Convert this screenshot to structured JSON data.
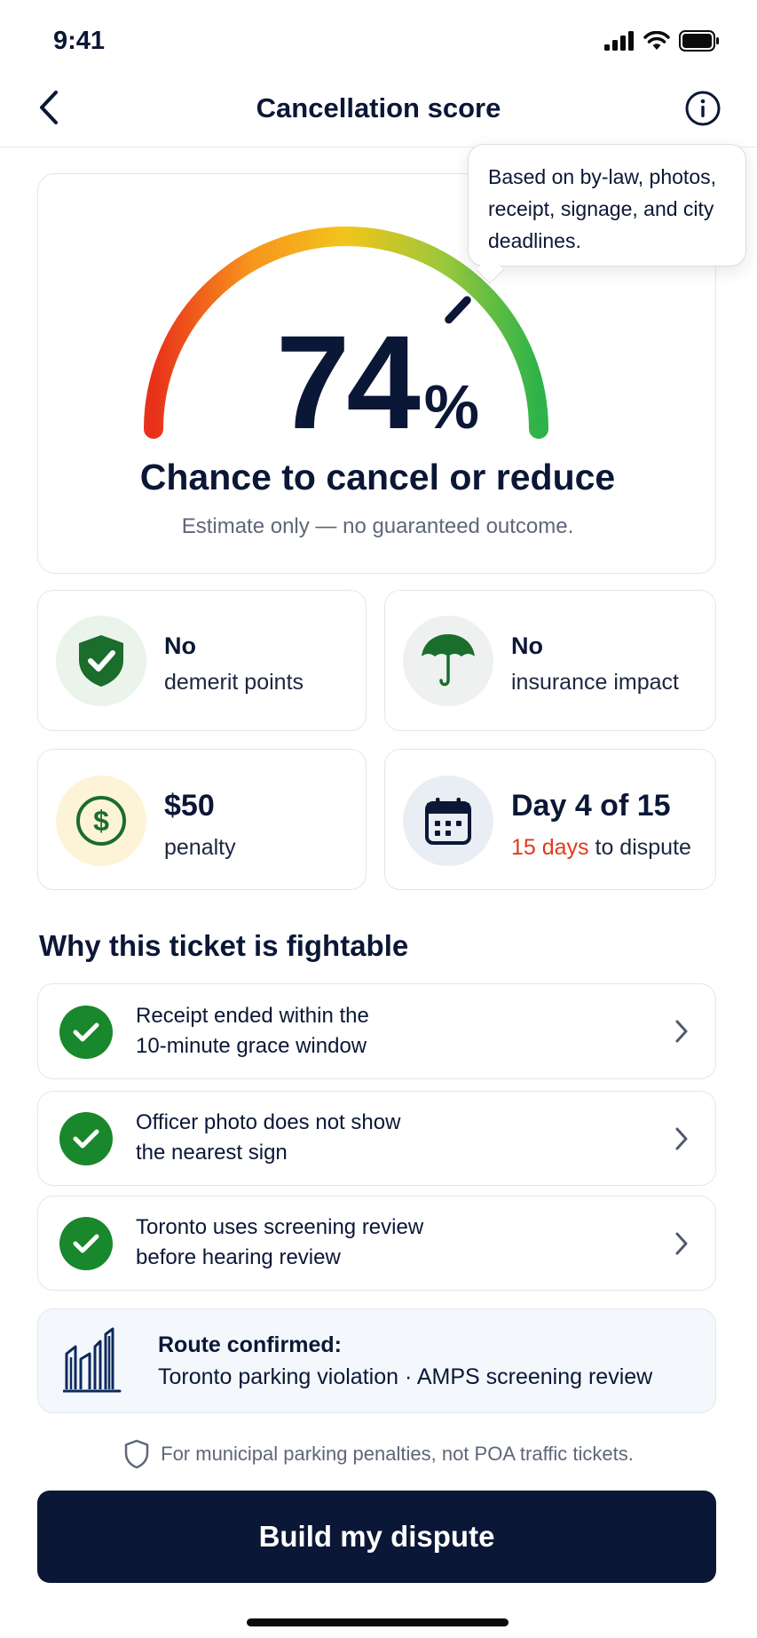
{
  "status_bar": {
    "time": "9:41"
  },
  "header": {
    "title": "Cancellation score"
  },
  "tooltip": {
    "text": "Based on by-law, photos, receipt, signage, and city deadlines."
  },
  "score": {
    "value": "74",
    "unit": "%",
    "fraction": 0.74,
    "caption": "Chance to cancel or reduce",
    "disclaimer": "Estimate only — no guaranteed outcome.",
    "gauge_colors": [
      "#e8311a",
      "#f7941d",
      "#f2c51a",
      "#9cc83b",
      "#2db34a"
    ]
  },
  "stats": {
    "demerit": {
      "line1": "No",
      "line2": "demerit points",
      "icon": "shield-check-icon"
    },
    "insurance": {
      "line1": "No",
      "line2": "insurance impact",
      "icon": "umbrella-icon"
    },
    "penalty": {
      "amount": "$50",
      "label": "penalty",
      "icon": "dollar-icon"
    },
    "deadline": {
      "title": "Day 4 of 15",
      "days_highlight": "15 days",
      "days_suffix": " to dispute",
      "icon": "calendar-icon"
    }
  },
  "reasons_section": {
    "title": "Why this ticket is fightable",
    "items": [
      {
        "line1": "Receipt ended within the",
        "line2": "10-minute grace window"
      },
      {
        "line1": "Officer photo does not show",
        "line2": "the nearest sign"
      },
      {
        "line1": "Toronto uses screening review",
        "line2": "before hearing review"
      }
    ]
  },
  "route": {
    "title": "Route confirmed:",
    "detail": "Toronto parking violation · AMPS screening review",
    "icon": "city-skyline-icon"
  },
  "footnote": {
    "text": "For municipal parking penalties, not POA traffic tickets.",
    "icon": "shield-outline-icon"
  },
  "cta": {
    "label": "Build my dispute"
  },
  "colors": {
    "navy": "#0b1736",
    "green": "#19872b",
    "red_accent": "#e23a1c",
    "route_bg": "#f4f7fc"
  }
}
